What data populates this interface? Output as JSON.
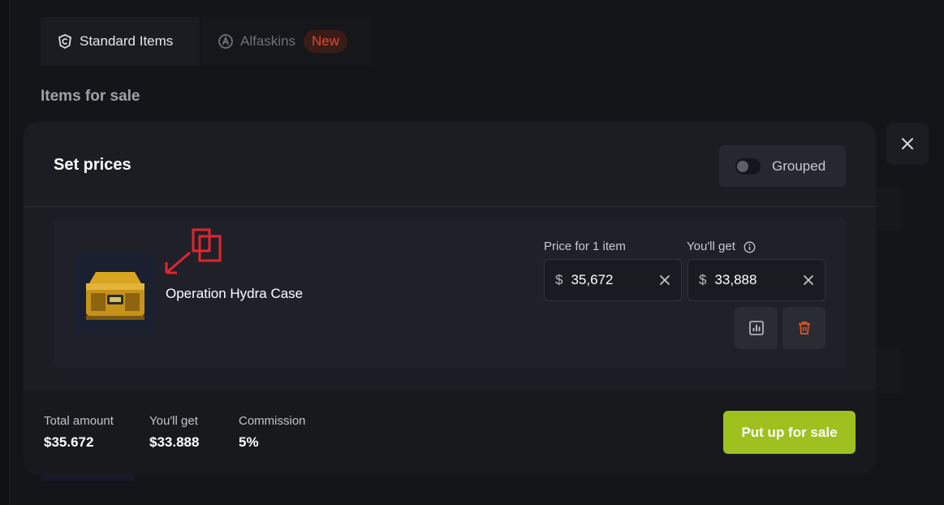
{
  "tabs": [
    {
      "label": "Standard Items",
      "icon": "standard-items-icon"
    },
    {
      "label": "Alfaskins",
      "icon": "alfaskins-icon",
      "badge": "New"
    }
  ],
  "section_title": "Items for sale",
  "modal": {
    "title": "Set prices",
    "grouped_label": "Grouped",
    "grouped_on": false,
    "item": {
      "name": "Operation Hydra Case",
      "price_label": "Price for 1 item",
      "receive_label": "You'll get",
      "currency": "$",
      "price_value": "35,672",
      "receive_value": "33,888"
    },
    "footer": {
      "total_label": "Total amount",
      "total_value": "$35.672",
      "get_label": "You'll get",
      "get_value": "$33.888",
      "commission_label": "Commission",
      "commission_value": "5%",
      "sale_button": "Put up for sale"
    }
  },
  "colors": {
    "accent_green": "#9ec120",
    "badge_red": "#e2482d",
    "delete_orange": "#e8551f",
    "marker_red": "#e0262e"
  }
}
